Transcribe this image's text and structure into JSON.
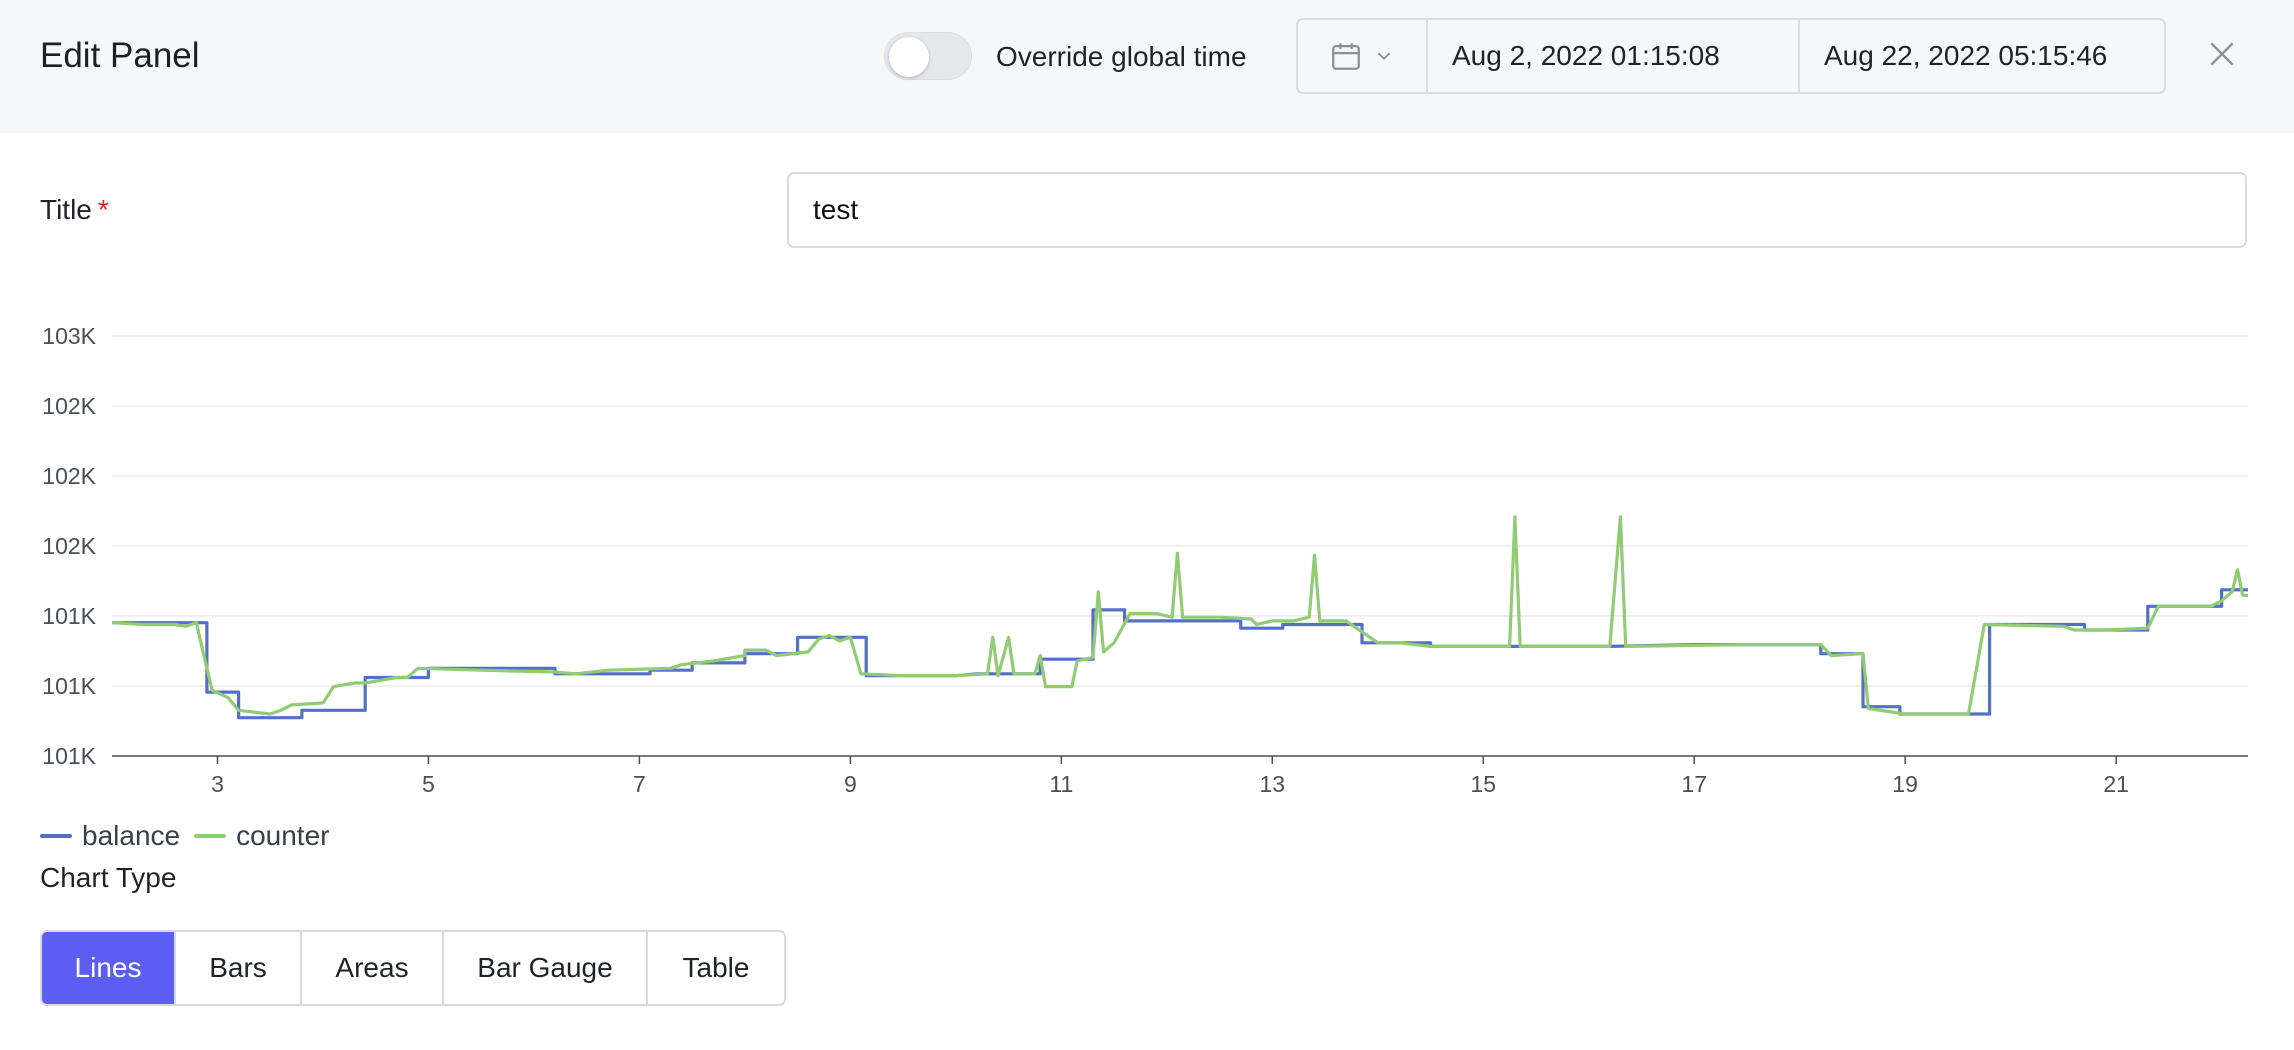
{
  "header": {
    "title": "Edit Panel",
    "override_label": "Override global time",
    "override_on": false,
    "range_from": "Aug 2, 2022 01:15:08",
    "range_to": "Aug 22, 2022 05:15:46",
    "calendar_icon": "calendar-icon",
    "close_icon": "close-icon"
  },
  "form": {
    "title_label": "Title",
    "required_mark": "*",
    "title_value": "test",
    "chart_type_label": "Chart Type"
  },
  "chart_types": [
    {
      "label": "Lines",
      "active": true
    },
    {
      "label": "Bars",
      "active": false
    },
    {
      "label": "Areas",
      "active": false
    },
    {
      "label": "Bar Gauge",
      "active": false
    },
    {
      "label": "Table",
      "active": false
    }
  ],
  "colors": {
    "accent": "#5b5ef0",
    "balance": "#5470c6",
    "counter": "#91cc75"
  },
  "chart_data": {
    "type": "line",
    "xlim": [
      2.0,
      22.25
    ],
    "ylim": [
      100700,
      103000
    ],
    "x_ticks": [
      3,
      5,
      7,
      9,
      11,
      13,
      15,
      17,
      19,
      21
    ],
    "y_ticks": [
      {
        "value": 100700,
        "label": "101K"
      },
      {
        "value": 101083,
        "label": "101K"
      },
      {
        "value": 101467,
        "label": "101K"
      },
      {
        "value": 101850,
        "label": "102K"
      },
      {
        "value": 102233,
        "label": "102K"
      },
      {
        "value": 102617,
        "label": "102K"
      },
      {
        "value": 103000,
        "label": "103K"
      }
    ],
    "grid": true,
    "legend_position": "bottom-left",
    "series": [
      {
        "name": "balance",
        "color": "#5470c6",
        "points": [
          [
            2.0,
            101430
          ],
          [
            2.8,
            101430
          ],
          [
            2.9,
            101430
          ],
          [
            2.9,
            101050
          ],
          [
            3.2,
            101050
          ],
          [
            3.2,
            100910
          ],
          [
            3.5,
            100910
          ],
          [
            3.8,
            100910
          ],
          [
            3.8,
            100950
          ],
          [
            4.4,
            100950
          ],
          [
            4.4,
            101130
          ],
          [
            5.0,
            101130
          ],
          [
            5.0,
            101180
          ],
          [
            6.2,
            101180
          ],
          [
            6.2,
            101150
          ],
          [
            7.1,
            101150
          ],
          [
            7.1,
            101170
          ],
          [
            7.5,
            101170
          ],
          [
            7.5,
            101210
          ],
          [
            8.0,
            101210
          ],
          [
            8.0,
            101260
          ],
          [
            8.5,
            101260
          ],
          [
            8.5,
            101350
          ],
          [
            9.15,
            101350
          ],
          [
            9.15,
            101140
          ],
          [
            10.0,
            101140
          ],
          [
            10.2,
            101150
          ],
          [
            10.3,
            101150
          ],
          [
            10.8,
            101150
          ],
          [
            10.8,
            101230
          ],
          [
            11.3,
            101230
          ],
          [
            11.3,
            101500
          ],
          [
            11.6,
            101500
          ],
          [
            11.6,
            101440
          ],
          [
            12.3,
            101440
          ],
          [
            12.3,
            101440
          ],
          [
            12.7,
            101440
          ],
          [
            12.7,
            101400
          ],
          [
            13.1,
            101400
          ],
          [
            13.1,
            101420
          ],
          [
            13.8,
            101420
          ],
          [
            13.8,
            101420
          ],
          [
            13.85,
            101420
          ],
          [
            13.85,
            101320
          ],
          [
            14.5,
            101320
          ],
          [
            14.5,
            101300
          ],
          [
            16.0,
            101300
          ],
          [
            16.2,
            101300
          ],
          [
            17.0,
            101310
          ],
          [
            18.2,
            101310
          ],
          [
            18.2,
            101260
          ],
          [
            18.6,
            101260
          ],
          [
            18.6,
            100970
          ],
          [
            18.95,
            100970
          ],
          [
            18.95,
            100930
          ],
          [
            19.8,
            100930
          ],
          [
            19.8,
            101420
          ],
          [
            20.7,
            101420
          ],
          [
            20.7,
            101390
          ],
          [
            21.3,
            101390
          ],
          [
            21.3,
            101520
          ],
          [
            22.0,
            101520
          ],
          [
            22.0,
            101610
          ],
          [
            22.25,
            101610
          ]
        ]
      },
      {
        "name": "counter",
        "color": "#91cc75",
        "points": [
          [
            2.0,
            101430
          ],
          [
            2.3,
            101420
          ],
          [
            2.6,
            101420
          ],
          [
            2.7,
            101410
          ],
          [
            2.8,
            101430
          ],
          [
            2.85,
            101300
          ],
          [
            2.95,
            101060
          ],
          [
            3.1,
            101020
          ],
          [
            3.2,
            100950
          ],
          [
            3.5,
            100930
          ],
          [
            3.6,
            100950
          ],
          [
            3.7,
            100980
          ],
          [
            4.0,
            100990
          ],
          [
            4.1,
            101080
          ],
          [
            4.3,
            101100
          ],
          [
            4.4,
            101100
          ],
          [
            4.7,
            101130
          ],
          [
            4.8,
            101130
          ],
          [
            4.9,
            101180
          ],
          [
            5.5,
            101170
          ],
          [
            6.2,
            101160
          ],
          [
            6.4,
            101150
          ],
          [
            6.7,
            101170
          ],
          [
            7.3,
            101180
          ],
          [
            7.4,
            101200
          ],
          [
            7.7,
            101220
          ],
          [
            8.0,
            101250
          ],
          [
            8.0,
            101280
          ],
          [
            8.2,
            101280
          ],
          [
            8.3,
            101250
          ],
          [
            8.6,
            101270
          ],
          [
            8.7,
            101340
          ],
          [
            8.8,
            101360
          ],
          [
            8.9,
            101330
          ],
          [
            9.0,
            101350
          ],
          [
            9.1,
            101150
          ],
          [
            9.5,
            101140
          ],
          [
            10.0,
            101140
          ],
          [
            10.3,
            101150
          ],
          [
            10.35,
            101350
          ],
          [
            10.4,
            101140
          ],
          [
            10.5,
            101350
          ],
          [
            10.55,
            101150
          ],
          [
            10.75,
            101150
          ],
          [
            10.8,
            101250
          ],
          [
            10.85,
            101080
          ],
          [
            11.1,
            101080
          ],
          [
            11.15,
            101220
          ],
          [
            11.3,
            101240
          ],
          [
            11.35,
            101600
          ],
          [
            11.4,
            101270
          ],
          [
            11.5,
            101320
          ],
          [
            11.65,
            101480
          ],
          [
            11.9,
            101480
          ],
          [
            12.05,
            101460
          ],
          [
            12.1,
            101810
          ],
          [
            12.15,
            101460
          ],
          [
            12.5,
            101460
          ],
          [
            12.8,
            101450
          ],
          [
            12.85,
            101420
          ],
          [
            13.0,
            101440
          ],
          [
            13.2,
            101440
          ],
          [
            13.35,
            101460
          ],
          [
            13.4,
            101800
          ],
          [
            13.45,
            101440
          ],
          [
            13.7,
            101440
          ],
          [
            14.0,
            101320
          ],
          [
            14.2,
            101320
          ],
          [
            14.5,
            101300
          ],
          [
            15.25,
            101300
          ],
          [
            15.3,
            102010
          ],
          [
            15.35,
            101300
          ],
          [
            16.2,
            101300
          ],
          [
            16.3,
            102010
          ],
          [
            16.35,
            101300
          ],
          [
            17.5,
            101310
          ],
          [
            18.2,
            101310
          ],
          [
            18.3,
            101250
          ],
          [
            18.6,
            101260
          ],
          [
            18.65,
            100960
          ],
          [
            19.0,
            100930
          ],
          [
            19.6,
            100930
          ],
          [
            19.75,
            101420
          ],
          [
            20.5,
            101410
          ],
          [
            20.6,
            101390
          ],
          [
            20.9,
            101390
          ],
          [
            21.3,
            101400
          ],
          [
            21.4,
            101520
          ],
          [
            21.9,
            101520
          ],
          [
            22.0,
            101550
          ],
          [
            22.1,
            101600
          ],
          [
            22.15,
            101720
          ],
          [
            22.2,
            101580
          ],
          [
            22.25,
            101580
          ]
        ]
      }
    ]
  }
}
